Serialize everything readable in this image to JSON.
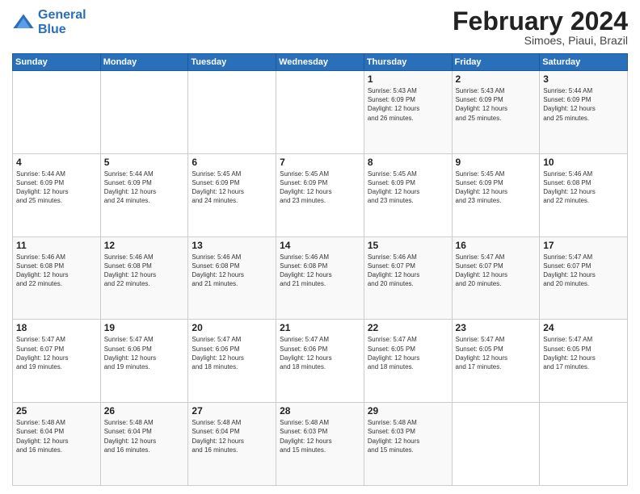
{
  "logo": {
    "line1": "General",
    "line2": "Blue"
  },
  "header": {
    "month": "February 2024",
    "location": "Simoes, Piaui, Brazil"
  },
  "days_of_week": [
    "Sunday",
    "Monday",
    "Tuesday",
    "Wednesday",
    "Thursday",
    "Friday",
    "Saturday"
  ],
  "weeks": [
    [
      {
        "day": "",
        "info": ""
      },
      {
        "day": "",
        "info": ""
      },
      {
        "day": "",
        "info": ""
      },
      {
        "day": "",
        "info": ""
      },
      {
        "day": "1",
        "info": "Sunrise: 5:43 AM\nSunset: 6:09 PM\nDaylight: 12 hours\nand 26 minutes."
      },
      {
        "day": "2",
        "info": "Sunrise: 5:43 AM\nSunset: 6:09 PM\nDaylight: 12 hours\nand 25 minutes."
      },
      {
        "day": "3",
        "info": "Sunrise: 5:44 AM\nSunset: 6:09 PM\nDaylight: 12 hours\nand 25 minutes."
      }
    ],
    [
      {
        "day": "4",
        "info": "Sunrise: 5:44 AM\nSunset: 6:09 PM\nDaylight: 12 hours\nand 25 minutes."
      },
      {
        "day": "5",
        "info": "Sunrise: 5:44 AM\nSunset: 6:09 PM\nDaylight: 12 hours\nand 24 minutes."
      },
      {
        "day": "6",
        "info": "Sunrise: 5:45 AM\nSunset: 6:09 PM\nDaylight: 12 hours\nand 24 minutes."
      },
      {
        "day": "7",
        "info": "Sunrise: 5:45 AM\nSunset: 6:09 PM\nDaylight: 12 hours\nand 23 minutes."
      },
      {
        "day": "8",
        "info": "Sunrise: 5:45 AM\nSunset: 6:09 PM\nDaylight: 12 hours\nand 23 minutes."
      },
      {
        "day": "9",
        "info": "Sunrise: 5:45 AM\nSunset: 6:09 PM\nDaylight: 12 hours\nand 23 minutes."
      },
      {
        "day": "10",
        "info": "Sunrise: 5:46 AM\nSunset: 6:08 PM\nDaylight: 12 hours\nand 22 minutes."
      }
    ],
    [
      {
        "day": "11",
        "info": "Sunrise: 5:46 AM\nSunset: 6:08 PM\nDaylight: 12 hours\nand 22 minutes."
      },
      {
        "day": "12",
        "info": "Sunrise: 5:46 AM\nSunset: 6:08 PM\nDaylight: 12 hours\nand 22 minutes."
      },
      {
        "day": "13",
        "info": "Sunrise: 5:46 AM\nSunset: 6:08 PM\nDaylight: 12 hours\nand 21 minutes."
      },
      {
        "day": "14",
        "info": "Sunrise: 5:46 AM\nSunset: 6:08 PM\nDaylight: 12 hours\nand 21 minutes."
      },
      {
        "day": "15",
        "info": "Sunrise: 5:46 AM\nSunset: 6:07 PM\nDaylight: 12 hours\nand 20 minutes."
      },
      {
        "day": "16",
        "info": "Sunrise: 5:47 AM\nSunset: 6:07 PM\nDaylight: 12 hours\nand 20 minutes."
      },
      {
        "day": "17",
        "info": "Sunrise: 5:47 AM\nSunset: 6:07 PM\nDaylight: 12 hours\nand 20 minutes."
      }
    ],
    [
      {
        "day": "18",
        "info": "Sunrise: 5:47 AM\nSunset: 6:07 PM\nDaylight: 12 hours\nand 19 minutes."
      },
      {
        "day": "19",
        "info": "Sunrise: 5:47 AM\nSunset: 6:06 PM\nDaylight: 12 hours\nand 19 minutes."
      },
      {
        "day": "20",
        "info": "Sunrise: 5:47 AM\nSunset: 6:06 PM\nDaylight: 12 hours\nand 18 minutes."
      },
      {
        "day": "21",
        "info": "Sunrise: 5:47 AM\nSunset: 6:06 PM\nDaylight: 12 hours\nand 18 minutes."
      },
      {
        "day": "22",
        "info": "Sunrise: 5:47 AM\nSunset: 6:05 PM\nDaylight: 12 hours\nand 18 minutes."
      },
      {
        "day": "23",
        "info": "Sunrise: 5:47 AM\nSunset: 6:05 PM\nDaylight: 12 hours\nand 17 minutes."
      },
      {
        "day": "24",
        "info": "Sunrise: 5:47 AM\nSunset: 6:05 PM\nDaylight: 12 hours\nand 17 minutes."
      }
    ],
    [
      {
        "day": "25",
        "info": "Sunrise: 5:48 AM\nSunset: 6:04 PM\nDaylight: 12 hours\nand 16 minutes."
      },
      {
        "day": "26",
        "info": "Sunrise: 5:48 AM\nSunset: 6:04 PM\nDaylight: 12 hours\nand 16 minutes."
      },
      {
        "day": "27",
        "info": "Sunrise: 5:48 AM\nSunset: 6:04 PM\nDaylight: 12 hours\nand 16 minutes."
      },
      {
        "day": "28",
        "info": "Sunrise: 5:48 AM\nSunset: 6:03 PM\nDaylight: 12 hours\nand 15 minutes."
      },
      {
        "day": "29",
        "info": "Sunrise: 5:48 AM\nSunset: 6:03 PM\nDaylight: 12 hours\nand 15 minutes."
      },
      {
        "day": "",
        "info": ""
      },
      {
        "day": "",
        "info": ""
      }
    ]
  ]
}
